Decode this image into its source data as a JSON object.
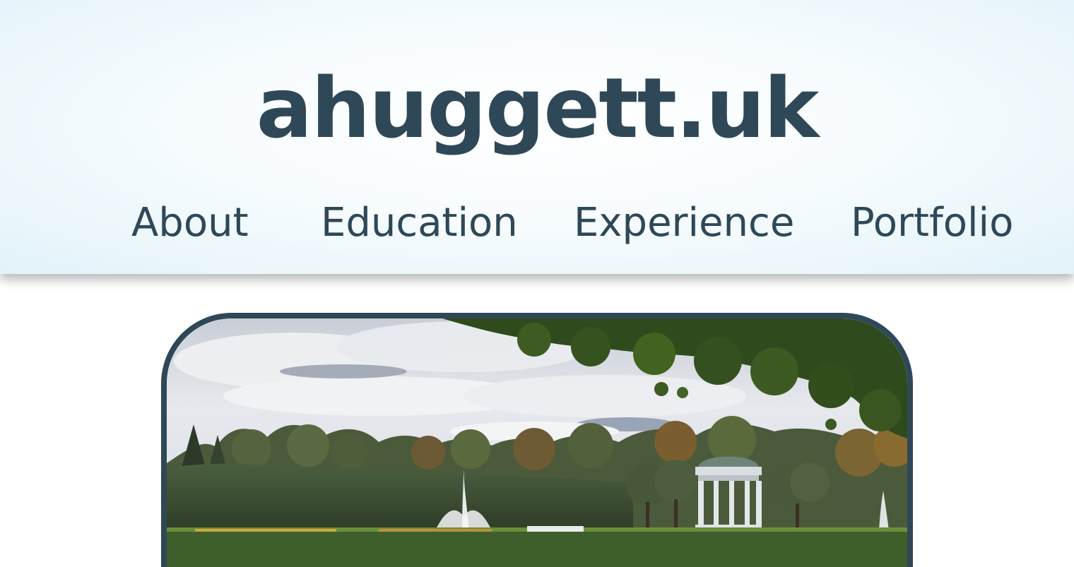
{
  "site": {
    "title": "ahuggett.uk"
  },
  "nav": {
    "items": [
      {
        "label": "About"
      },
      {
        "label": "Education"
      },
      {
        "label": "Experience"
      },
      {
        "label": "Portfolio"
      }
    ]
  },
  "hero": {
    "image_icon": "park-fountain-gazebo-photo"
  },
  "colors": {
    "accent": "#2f4858",
    "header_bg": "#eaf6fa",
    "page_bg": "#ffffff"
  }
}
